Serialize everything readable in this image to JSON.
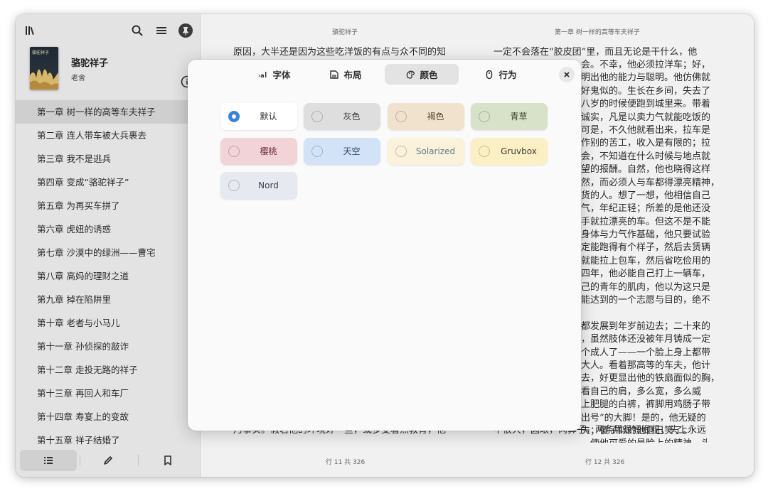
{
  "sidebar": {
    "book": {
      "cover_text": "骆驼祥子",
      "title": "骆驼祥子",
      "author": "老舍"
    },
    "icons": {
      "library": "library-icon",
      "search": "search-icon",
      "menu": "hamburger-menu-icon",
      "pin": "pin-icon",
      "info": "info-icon"
    },
    "toc": [
      {
        "label": "第一章  树一样的高等车夫祥子"
      },
      {
        "label": "第二章  连人带车被大兵裹去"
      },
      {
        "label": "第三章  我不是逃兵"
      },
      {
        "label": "第四章  变成“骆驼祥子”"
      },
      {
        "label": "第五章  为再买车拼了"
      },
      {
        "label": "第六章  虎妞的诱惑"
      },
      {
        "label": "第七章  沙漠中的绿洲——曹宅"
      },
      {
        "label": "第八章  高妈的理财之道"
      },
      {
        "label": "第九章  掉在陷阱里"
      },
      {
        "label": "第十章  老者与小马儿"
      },
      {
        "label": "第十一章  孙侦探的敲诈"
      },
      {
        "label": "第十二章  走投无路的祥子"
      },
      {
        "label": "第十三章  再回人和车厂"
      },
      {
        "label": "第十四章  寿宴上的变故"
      },
      {
        "label": "第十五章  祥子结婚了"
      }
    ],
    "active_toc_index": 0,
    "footer": {
      "tabs": [
        "contents-list-icon",
        "annotation-pencil-icon",
        "bookmark-icon"
      ],
      "active": 0
    }
  },
  "reader": {
    "left_page": {
      "header": "骆驼祥子",
      "footer": "行 11 共 326",
      "top_line": "原因，大半还是因为这些吃洋饭的有点与众不同的知",
      "bottom_line": "乃事实。假若他的环境好一些，或多受着点教育，他"
    },
    "right_page": {
      "header": "第一章  树一样的高等车夫祥子",
      "footer": "行 12 共 326",
      "top_line": "一定不会落在“胶皮团”里，而且无论是干什么，他",
      "lines": [
        "会。不幸，他必须拉洋车；好，",
        "明出他的能力与聪明。他仿佛就",
        "好鬼似的。生长在乡间，失去了",
        "八岁的时候便跑到城里来。带着",
        "诚实，凡是以卖力气就能吃饭的",
        "可是，不久他就看出来，拉车是",
        "作别的苦工，收入是有限的；拉",
        "会，不知道在什么时候与地点就",
        "望的报酬。自然，他也晓得这样",
        "然，而必须人与车都得漂亮精神，",
        "货的人。想了一想，他相信自己",
        "气，年纪正轻；所差的是他还没",
        "手就拉漂亮的车。但这不是不能",
        "身体与力气作基础，他只要试验",
        "定能跑得有个样子，然后去赁辆",
        "就能拉上包车，然后省吃俭用的",
        "四年，他必能自己打上一辆车，",
        "己的青年的肌肉，他以为这只是",
        "能达到的一个志愿与目的，绝不",
        "",
        "都发展到年岁前边去；二十来的",
        "，虽然肢体还没被年月铸成一定",
        "个成人了——一个脸上身上都带",
        "大人。看着那高等的车夫，他计",
        "去，好更显出他的铁扇面似的胸，",
        "看自己的肩，多么宽，多么威",
        "上肥腿的白裤，裤脚用鸡肠子带",
        "出号”的大脚！是的，他无疑的",
        "夫；傻子似的他自己笑了。",
        "，使他可爱的是脸上的精神。头"
      ],
      "bottom_line": "不很大，圆眼，肉鼻子，两条眉很短很粗，头上永远"
    }
  },
  "dialog": {
    "tabs": [
      {
        "label": "字体",
        "icon": "font-icon"
      },
      {
        "label": "布局",
        "icon": "layout-icon"
      },
      {
        "label": "颜色",
        "icon": "palette-icon"
      },
      {
        "label": "行为",
        "icon": "mouse-icon"
      }
    ],
    "active_tab": 2,
    "close_icon": "close-icon",
    "themes": [
      {
        "label": "默认",
        "bg": "#ffffff",
        "fg": "#2e2e2e",
        "selected": true
      },
      {
        "label": "灰色",
        "bg": "#dedede",
        "fg": "#3a3a3a",
        "selected": false
      },
      {
        "label": "褐色",
        "bg": "#f0e2cc",
        "fg": "#5b4636",
        "selected": false
      },
      {
        "label": "青草",
        "bg": "#d7e2c8",
        "fg": "#3e4a2e",
        "selected": false
      },
      {
        "label": "樱桃",
        "bg": "#f1d3d8",
        "fg": "#6d2b36",
        "selected": false
      },
      {
        "label": "天空",
        "bg": "#d2e3f7",
        "fg": "#2b4766",
        "selected": false
      },
      {
        "label": "Solarized",
        "bg": "#fbf2dc",
        "fg": "#657b83",
        "selected": false
      },
      {
        "label": "Gruvbox",
        "bg": "#fbf0c4",
        "fg": "#3c3836",
        "selected": false
      },
      {
        "label": "Nord",
        "bg": "#e6e9ef",
        "fg": "#3b4252",
        "selected": false
      }
    ]
  }
}
